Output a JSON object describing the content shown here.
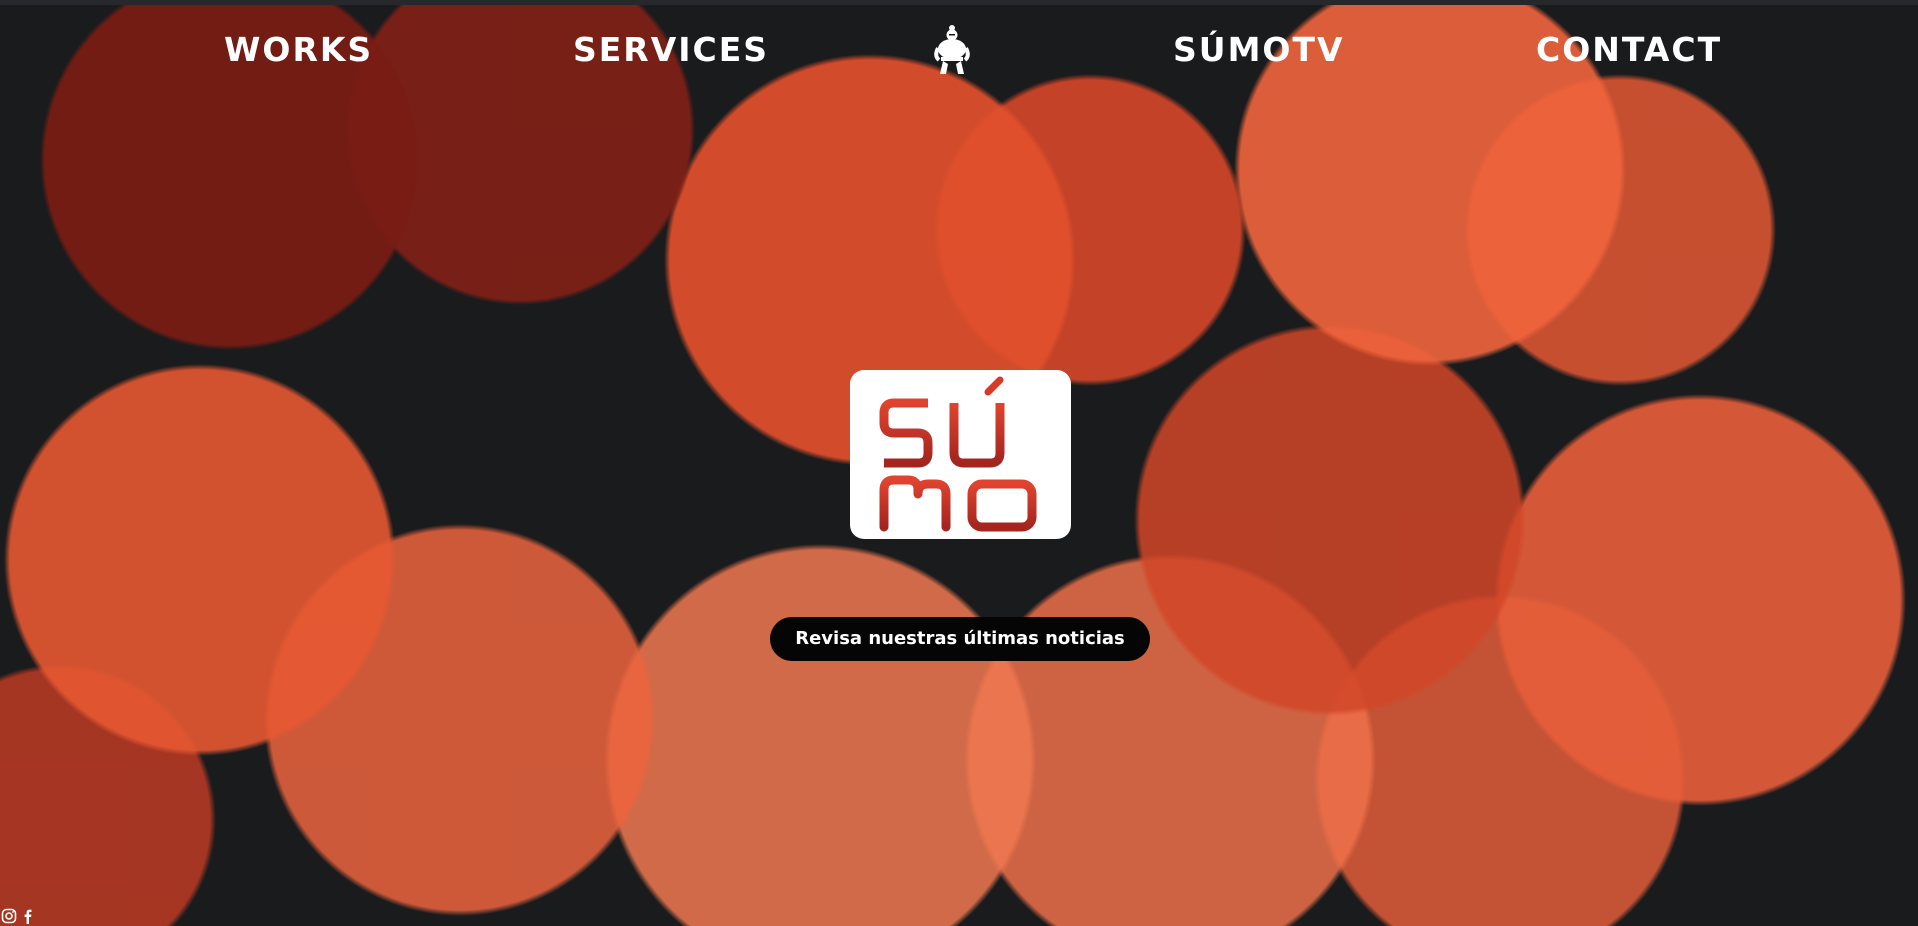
{
  "nav": {
    "items": [
      {
        "label": "WORKS"
      },
      {
        "label": "SERVICES"
      },
      {
        "label": "SÚMOTV"
      },
      {
        "label": "CONTACT"
      }
    ],
    "center_icon": "sumo-wrestler-icon"
  },
  "hero": {
    "logo_text": "SÚMO",
    "cta_label": "Revisa nuestras últimas noticias"
  },
  "social": {
    "icons": [
      "instagram-icon",
      "facebook-icon"
    ]
  },
  "colors": {
    "brand_red": "#b52a24",
    "background": "#1a1b1d",
    "accent_orange": "#e8573a",
    "button_bg": "#050505",
    "text": "#ffffff"
  }
}
